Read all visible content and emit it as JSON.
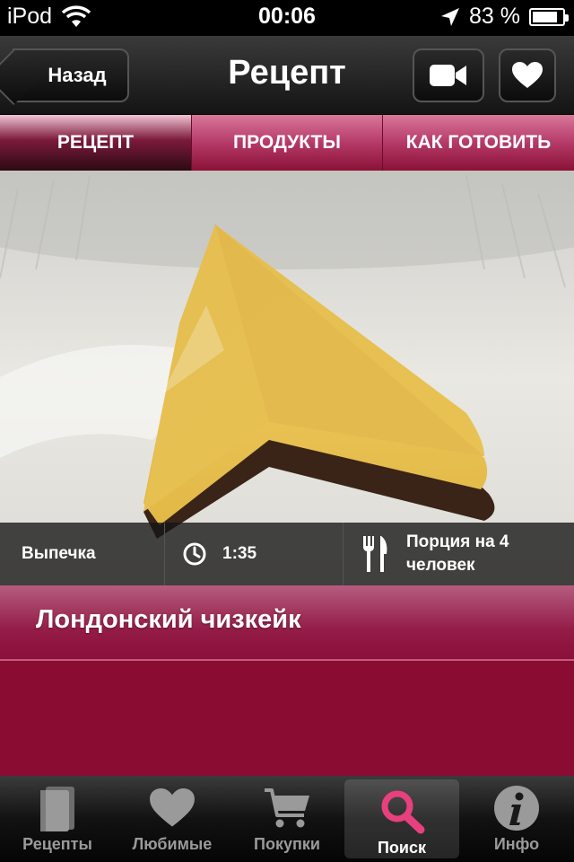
{
  "status_bar": {
    "carrier": "iPod",
    "time": "00:06",
    "battery_text": "83 %",
    "battery_level": 0.83
  },
  "nav": {
    "back_label": "Назад",
    "title": "Рецепт",
    "video_icon": "video-camera-icon",
    "favorite_icon": "heart-icon"
  },
  "segments": [
    {
      "label": "РЕЦЕПТ",
      "active": true
    },
    {
      "label": "ПРОДУКТЫ",
      "active": false
    },
    {
      "label": "КАК ГОТОВИТЬ",
      "active": false
    }
  ],
  "recipe": {
    "category": "Выпечка",
    "time": "1:35",
    "servings_line1": "Порция на 4",
    "servings_line2": "человек",
    "title": "Лондонский чизкейк"
  },
  "tabs": [
    {
      "label": "Рецепты",
      "icon": "book-icon",
      "active": false
    },
    {
      "label": "Любимые",
      "icon": "heart-icon",
      "active": false
    },
    {
      "label": "Покупки",
      "icon": "cart-icon",
      "active": false
    },
    {
      "label": "Поиск",
      "icon": "search-icon",
      "active": true
    },
    {
      "label": "Инфо",
      "icon": "info-icon",
      "active": false
    }
  ],
  "colors": {
    "accent": "#8a0c33",
    "segment": "#b53a67",
    "search_icon": "#e8407f"
  }
}
